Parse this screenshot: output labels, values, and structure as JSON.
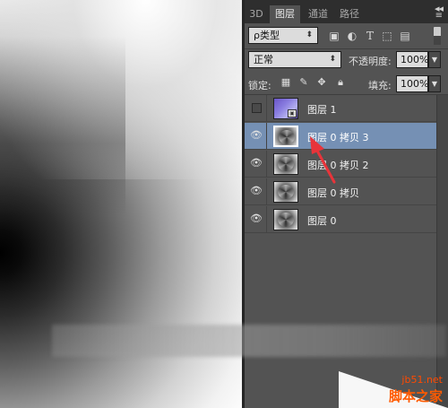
{
  "tabs": [
    {
      "label": "3D"
    },
    {
      "label": "图层",
      "active": true
    },
    {
      "label": "通道"
    },
    {
      "label": "路径"
    }
  ],
  "panel_menu": {
    "collapse_glyph": "◂◂",
    "menu_glyph": "≡"
  },
  "filter": {
    "label": "ρ类型"
  },
  "blend": {
    "mode": "正常",
    "opacity_label": "不透明度:",
    "opacity_value": "100%"
  },
  "lock": {
    "label": "锁定:",
    "fill_label": "填充:",
    "fill_value": "100%"
  },
  "layers": [
    {
      "name": "图层 1",
      "visible": false,
      "selected": false,
      "thumb": "purple-smart-object"
    },
    {
      "name": "图层 0 拷贝 3",
      "visible": true,
      "selected": true,
      "thumb": "swirl"
    },
    {
      "name": "图层 0 拷贝 2",
      "visible": true,
      "selected": false,
      "thumb": "swirl"
    },
    {
      "name": "图层 0 拷贝",
      "visible": true,
      "selected": false,
      "thumb": "swirl"
    },
    {
      "name": "图层 0",
      "visible": true,
      "selected": false,
      "thumb": "swirl"
    }
  ],
  "watermark": {
    "site": "jb51.net",
    "brand": "脚本之家"
  },
  "colors": {
    "selected_row": "#7590b4",
    "panel_bg": "#535353",
    "annotation_arrow": "#e8343a"
  }
}
